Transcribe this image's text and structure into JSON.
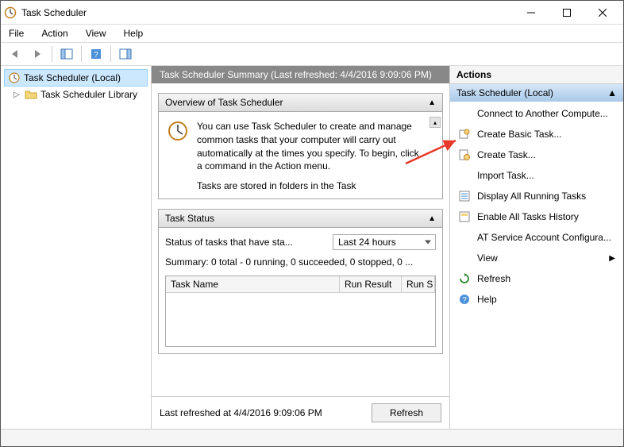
{
  "title": "Task Scheduler",
  "menu": {
    "file": "File",
    "action": "Action",
    "view": "View",
    "help": "Help"
  },
  "tree": {
    "root": "Task Scheduler (Local)",
    "child": "Task Scheduler Library"
  },
  "summaryHeader": "Task Scheduler Summary (Last refreshed: 4/4/2016 9:09:06 PM)",
  "overview": {
    "title": "Overview of Task Scheduler",
    "text": "You can use Task Scheduler to create and manage common tasks that your computer will carry out automatically at the times you specify. To begin, click a command in the Action menu.",
    "more": "Tasks are stored in folders in the Task"
  },
  "taskStatus": {
    "title": "Task Status",
    "label": "Status of tasks that have sta...",
    "dropdown": "Last 24 hours",
    "summary": "Summary: 0 total - 0 running, 0 succeeded, 0 stopped, 0 ...",
    "col1": "Task Name",
    "col2": "Run Result",
    "col3": "Run S"
  },
  "lastRefreshed": "Last refreshed at 4/4/2016 9:09:06 PM",
  "refreshBtn": "Refresh",
  "actions": {
    "header": "Actions",
    "sub": "Task Scheduler (Local)",
    "items": [
      "Connect to Another Compute...",
      "Create Basic Task...",
      "Create Task...",
      "Import Task...",
      "Display All Running Tasks",
      "Enable All Tasks History",
      "AT Service Account Configura...",
      "View",
      "Refresh",
      "Help"
    ]
  }
}
